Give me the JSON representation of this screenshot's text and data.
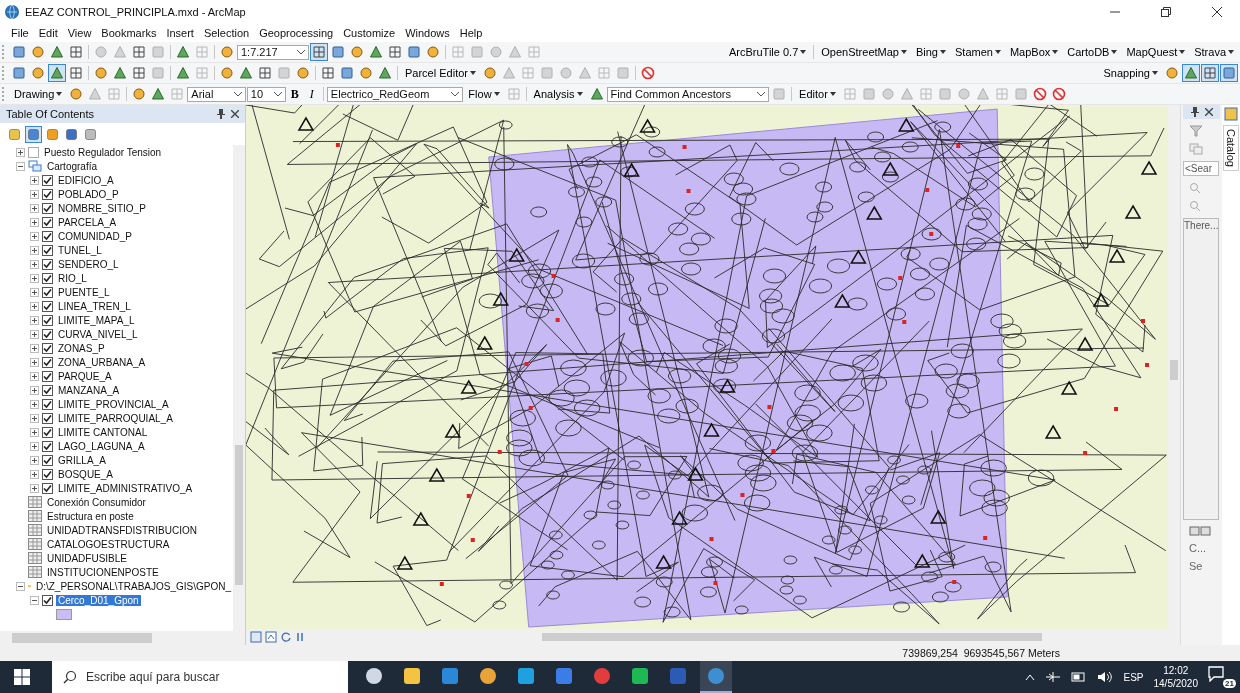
{
  "window": {
    "title": "EEAZ CONTROL_PRINCIPLA.mxd - ArcMap"
  },
  "menu": [
    "File",
    "Edit",
    "View",
    "Bookmarks",
    "Insert",
    "Selection",
    "Geoprocessing",
    "Customize",
    "Windows",
    "Help"
  ],
  "toolbars": [
    [
      {
        "kind": "icon",
        "disabled": false,
        "pressed": false
      },
      {
        "kind": "icon",
        "disabled": false,
        "pressed": false
      },
      {
        "kind": "icon",
        "disabled": false,
        "pressed": false
      },
      {
        "kind": "icon",
        "disabled": false,
        "pressed": false
      },
      {
        "kind": "sep"
      },
      {
        "kind": "icon",
        "disabled": true,
        "pressed": false
      },
      {
        "kind": "icon",
        "disabled": true,
        "pressed": false
      },
      {
        "kind": "icon",
        "disabled": false,
        "pressed": false
      },
      {
        "kind": "icon",
        "disabled": true,
        "pressed": false
      },
      {
        "kind": "sep"
      },
      {
        "kind": "icon",
        "disabled": false,
        "pressed": false
      },
      {
        "kind": "icon",
        "disabled": true,
        "pressed": false
      },
      {
        "kind": "sep"
      },
      {
        "kind": "icon",
        "disabled": false,
        "pressed": false
      },
      {
        "kind": "combo",
        "value": "1:7.217"
      },
      {
        "kind": "icon",
        "disabled": false,
        "pressed": true
      },
      {
        "kind": "icon",
        "disabled": false,
        "pressed": false
      },
      {
        "kind": "icon",
        "disabled": false,
        "pressed": false
      },
      {
        "kind": "icon",
        "disabled": false,
        "pressed": false
      },
      {
        "kind": "icon",
        "disabled": false,
        "pressed": false
      },
      {
        "kind": "icon",
        "disabled": false,
        "pressed": false
      },
      {
        "kind": "icon",
        "disabled": false,
        "pressed": false
      },
      {
        "kind": "sep"
      },
      {
        "kind": "icon",
        "disabled": true,
        "pressed": false
      },
      {
        "kind": "icon",
        "disabled": true,
        "pressed": false
      },
      {
        "kind": "icon",
        "disabled": true,
        "pressed": false
      },
      {
        "kind": "icon",
        "disabled": true,
        "pressed": false
      },
      {
        "kind": "icon",
        "disabled": true,
        "pressed": false
      },
      {
        "kind": "spacer"
      },
      {
        "kind": "menu",
        "label": "ArcBruTile 0.7"
      },
      {
        "kind": "sep"
      },
      {
        "kind": "menu",
        "label": "OpenStreetMap"
      },
      {
        "kind": "menu",
        "label": "Bing"
      },
      {
        "kind": "menu",
        "label": "Stamen"
      },
      {
        "kind": "menu",
        "label": "MapBox"
      },
      {
        "kind": "menu",
        "label": "CartoDB"
      },
      {
        "kind": "menu",
        "label": "MapQuest"
      },
      {
        "kind": "menu",
        "label": "Strava"
      }
    ],
    [
      {
        "kind": "icon",
        "disabled": false,
        "pressed": false
      },
      {
        "kind": "icon",
        "disabled": false,
        "pressed": false
      },
      {
        "kind": "icon",
        "disabled": false,
        "pressed": true
      },
      {
        "kind": "icon",
        "disabled": false,
        "pressed": false
      },
      {
        "kind": "sep"
      },
      {
        "kind": "icon",
        "disabled": false,
        "pressed": false
      },
      {
        "kind": "icon",
        "disabled": false,
        "pressed": false
      },
      {
        "kind": "icon",
        "disabled": false,
        "pressed": false
      },
      {
        "kind": "icon",
        "disabled": true,
        "pressed": false
      },
      {
        "kind": "sep"
      },
      {
        "kind": "icon",
        "disabled": false,
        "pressed": false
      },
      {
        "kind": "icon",
        "disabled": true,
        "pressed": false
      },
      {
        "kind": "sep"
      },
      {
        "kind": "icon",
        "disabled": false,
        "pressed": false
      },
      {
        "kind": "icon",
        "disabled": false,
        "pressed": false
      },
      {
        "kind": "icon",
        "disabled": false,
        "pressed": false
      },
      {
        "kind": "icon",
        "disabled": true,
        "pressed": false
      },
      {
        "kind": "icon",
        "disabled": false,
        "pressed": false
      },
      {
        "kind": "sep"
      },
      {
        "kind": "icon",
        "disabled": false,
        "pressed": false
      },
      {
        "kind": "icon",
        "disabled": false,
        "pressed": false
      },
      {
        "kind": "icon",
        "disabled": false,
        "pressed": false
      },
      {
        "kind": "icon",
        "disabled": false,
        "pressed": false
      },
      {
        "kind": "sep"
      },
      {
        "kind": "menu",
        "label": "Parcel Editor"
      },
      {
        "kind": "icon",
        "disabled": false,
        "pressed": false
      },
      {
        "kind": "icon",
        "disabled": true,
        "pressed": false
      },
      {
        "kind": "icon",
        "disabled": true,
        "pressed": false
      },
      {
        "kind": "icon",
        "disabled": true,
        "pressed": false
      },
      {
        "kind": "icon",
        "disabled": true,
        "pressed": false
      },
      {
        "kind": "icon",
        "disabled": true,
        "pressed": false
      },
      {
        "kind": "icon",
        "disabled": true,
        "pressed": false
      },
      {
        "kind": "icon",
        "disabled": true,
        "pressed": false
      },
      {
        "kind": "sep"
      },
      {
        "kind": "stop"
      },
      {
        "kind": "spacer"
      },
      {
        "kind": "menu",
        "label": "Snapping"
      },
      {
        "kind": "icon",
        "disabled": false,
        "pressed": false
      },
      {
        "kind": "icon",
        "disabled": false,
        "pressed": true
      },
      {
        "kind": "icon",
        "disabled": false,
        "pressed": true
      },
      {
        "kind": "icon",
        "disabled": false,
        "pressed": true
      }
    ],
    [
      {
        "kind": "menu",
        "label": "Drawing"
      },
      {
        "kind": "icon",
        "disabled": false,
        "pressed": false
      },
      {
        "kind": "icon",
        "disabled": true,
        "pressed": false
      },
      {
        "kind": "icon",
        "disabled": true,
        "pressed": false
      },
      {
        "kind": "sep"
      },
      {
        "kind": "icon",
        "disabled": false,
        "pressed": false
      },
      {
        "kind": "icon",
        "disabled": false,
        "pressed": false
      },
      {
        "kind": "icon",
        "disabled": true,
        "pressed": false
      },
      {
        "kind": "combo",
        "value": "Arial"
      },
      {
        "kind": "combo",
        "value": "10"
      },
      {
        "kind": "text",
        "label": "B"
      },
      {
        "kind": "text",
        "label": "I"
      },
      {
        "kind": "sep"
      },
      {
        "kind": "combo",
        "value": "Electrico_RedGeom"
      },
      {
        "kind": "menu",
        "label": "Flow"
      },
      {
        "kind": "icon",
        "disabled": true,
        "pressed": false
      },
      {
        "kind": "sep"
      },
      {
        "kind": "menu",
        "label": "Analysis"
      },
      {
        "kind": "icon",
        "disabled": false,
        "pressed": false
      },
      {
        "kind": "combo",
        "value": "Find Common Ancestors"
      },
      {
        "kind": "icon",
        "disabled": true,
        "pressed": false
      },
      {
        "kind": "sep"
      },
      {
        "kind": "menu",
        "label": "Editor"
      },
      {
        "kind": "icon",
        "disabled": true,
        "pressed": false
      },
      {
        "kind": "icon",
        "disabled": true,
        "pressed": false
      },
      {
        "kind": "icon",
        "disabled": true,
        "pressed": false
      },
      {
        "kind": "icon",
        "disabled": true,
        "pressed": false
      },
      {
        "kind": "icon",
        "disabled": true,
        "pressed": false
      },
      {
        "kind": "icon",
        "disabled": true,
        "pressed": false
      },
      {
        "kind": "icon",
        "disabled": true,
        "pressed": false
      },
      {
        "kind": "icon",
        "disabled": true,
        "pressed": false
      },
      {
        "kind": "icon",
        "disabled": true,
        "pressed": false
      },
      {
        "kind": "icon",
        "disabled": true,
        "pressed": false
      },
      {
        "kind": "stop"
      },
      {
        "kind": "stop"
      }
    ]
  ],
  "toc": {
    "title": "Table Of Contents",
    "tabs": [
      {
        "selected": false
      },
      {
        "selected": true
      },
      {
        "selected": false
      },
      {
        "selected": false
      },
      {
        "selected": false
      }
    ],
    "items": [
      {
        "kind": "layer",
        "label": "Puesto Regulador Tension",
        "checked": false,
        "expanded": false,
        "selected": false
      },
      {
        "kind": "group",
        "label": "Cartografía",
        "expanded": true,
        "selected": false,
        "children": [
          {
            "kind": "layer",
            "label": "EDIFICIO_A",
            "checked": true,
            "expanded": false,
            "selected": false
          },
          {
            "kind": "layer",
            "label": "POBLADO_P",
            "checked": true,
            "expanded": false,
            "selected": false
          },
          {
            "kind": "layer",
            "label": "NOMBRE_SITIO_P",
            "checked": true,
            "expanded": false,
            "selected": false
          },
          {
            "kind": "layer",
            "label": "PARCELA_A",
            "checked": true,
            "expanded": false,
            "selected": false
          },
          {
            "kind": "layer",
            "label": "COMUNIDAD_P",
            "checked": true,
            "expanded": false,
            "selected": false
          },
          {
            "kind": "layer",
            "label": "TUNEL_L",
            "checked": true,
            "expanded": false,
            "selected": false
          },
          {
            "kind": "layer",
            "label": "SENDERO_L",
            "checked": true,
            "expanded": false,
            "selected": false
          },
          {
            "kind": "layer",
            "label": "RIO_L",
            "checked": true,
            "expanded": false,
            "selected": false
          },
          {
            "kind": "layer",
            "label": "PUENTE_L",
            "checked": true,
            "expanded": false,
            "selected": false
          },
          {
            "kind": "layer",
            "label": "LINEA_TREN_L",
            "checked": true,
            "expanded": false,
            "selected": false
          },
          {
            "kind": "layer",
            "label": "LIMITE_MAPA_L",
            "checked": true,
            "expanded": false,
            "selected": false
          },
          {
            "kind": "layer",
            "label": "CURVA_NIVEL_L",
            "checked": true,
            "expanded": false,
            "selected": false
          },
          {
            "kind": "layer",
            "label": "ZONAS_P",
            "checked": true,
            "expanded": false,
            "selected": false
          },
          {
            "kind": "layer",
            "label": "ZONA_URBANA_A",
            "checked": true,
            "expanded": false,
            "selected": false
          },
          {
            "kind": "layer",
            "label": "PARQUE_A",
            "checked": true,
            "expanded": false,
            "selected": false
          },
          {
            "kind": "layer",
            "label": "MANZANA_A",
            "checked": true,
            "expanded": false,
            "selected": false
          },
          {
            "kind": "layer",
            "label": "LIMITE_PROVINCIAL_A",
            "checked": true,
            "expanded": false,
            "selected": false
          },
          {
            "kind": "layer",
            "label": "LIMITE_PARROQUIAL_A",
            "checked": true,
            "expanded": false,
            "selected": false
          },
          {
            "kind": "layer",
            "label": "LIMITE CANTONAL",
            "checked": true,
            "expanded": false,
            "selected": false
          },
          {
            "kind": "layer",
            "label": "LAGO_LAGUNA_A",
            "checked": true,
            "expanded": false,
            "selected": false
          },
          {
            "kind": "layer",
            "label": "GRILLA_A",
            "checked": true,
            "expanded": false,
            "selected": false
          },
          {
            "kind": "layer",
            "label": "BOSQUE_A",
            "checked": true,
            "expanded": false,
            "selected": false
          },
          {
            "kind": "layer",
            "label": "LIMITE_ADMINISTRATIVO_A",
            "checked": true,
            "expanded": false,
            "selected": false
          }
        ]
      },
      {
        "kind": "table",
        "label": "Conexión Consumidor",
        "selected": false
      },
      {
        "kind": "table",
        "label": "Estructura en poste",
        "selected": false
      },
      {
        "kind": "table",
        "label": "UNIDADTRANSFDISTRIBUCION",
        "selected": false
      },
      {
        "kind": "table",
        "label": "CATALOGOESTRUCTURA",
        "selected": false
      },
      {
        "kind": "table",
        "label": "UNIDADFUSIBLE",
        "selected": false
      },
      {
        "kind": "table",
        "label": "INSTITUCIONENPOSTE",
        "selected": false
      },
      {
        "kind": "folder",
        "label": "D:\\Z_PERSONAL\\TRABAJOS_GIS\\GPON_",
        "expanded": true,
        "selected": false,
        "children": [
          {
            "kind": "layer",
            "label": "Cerco_D01_Gpon",
            "checked": true,
            "expanded": true,
            "selected": true,
            "children": [
              {
                "kind": "swatch",
                "color": "#cbbcf4"
              }
            ]
          }
        ]
      }
    ]
  },
  "catalog": {
    "tab": "Catalog",
    "search_placeholder": "<Sear",
    "message": "There...",
    "items": [
      "C...",
      "Se"
    ]
  },
  "status_bar": {
    "coordinates": "739869,254  9693545,567 Meters"
  },
  "taskbar": {
    "search_placeholder": "Escribe aquí para buscar",
    "apps": [
      {
        "active": false
      },
      {
        "active": false
      },
      {
        "active": false
      },
      {
        "active": false
      },
      {
        "active": false
      },
      {
        "active": false
      },
      {
        "active": false
      },
      {
        "active": false
      },
      {
        "active": false
      },
      {
        "active": true
      }
    ],
    "language": "ESP",
    "time": "12:02",
    "date": "14/5/2020",
    "notifications": "21"
  }
}
